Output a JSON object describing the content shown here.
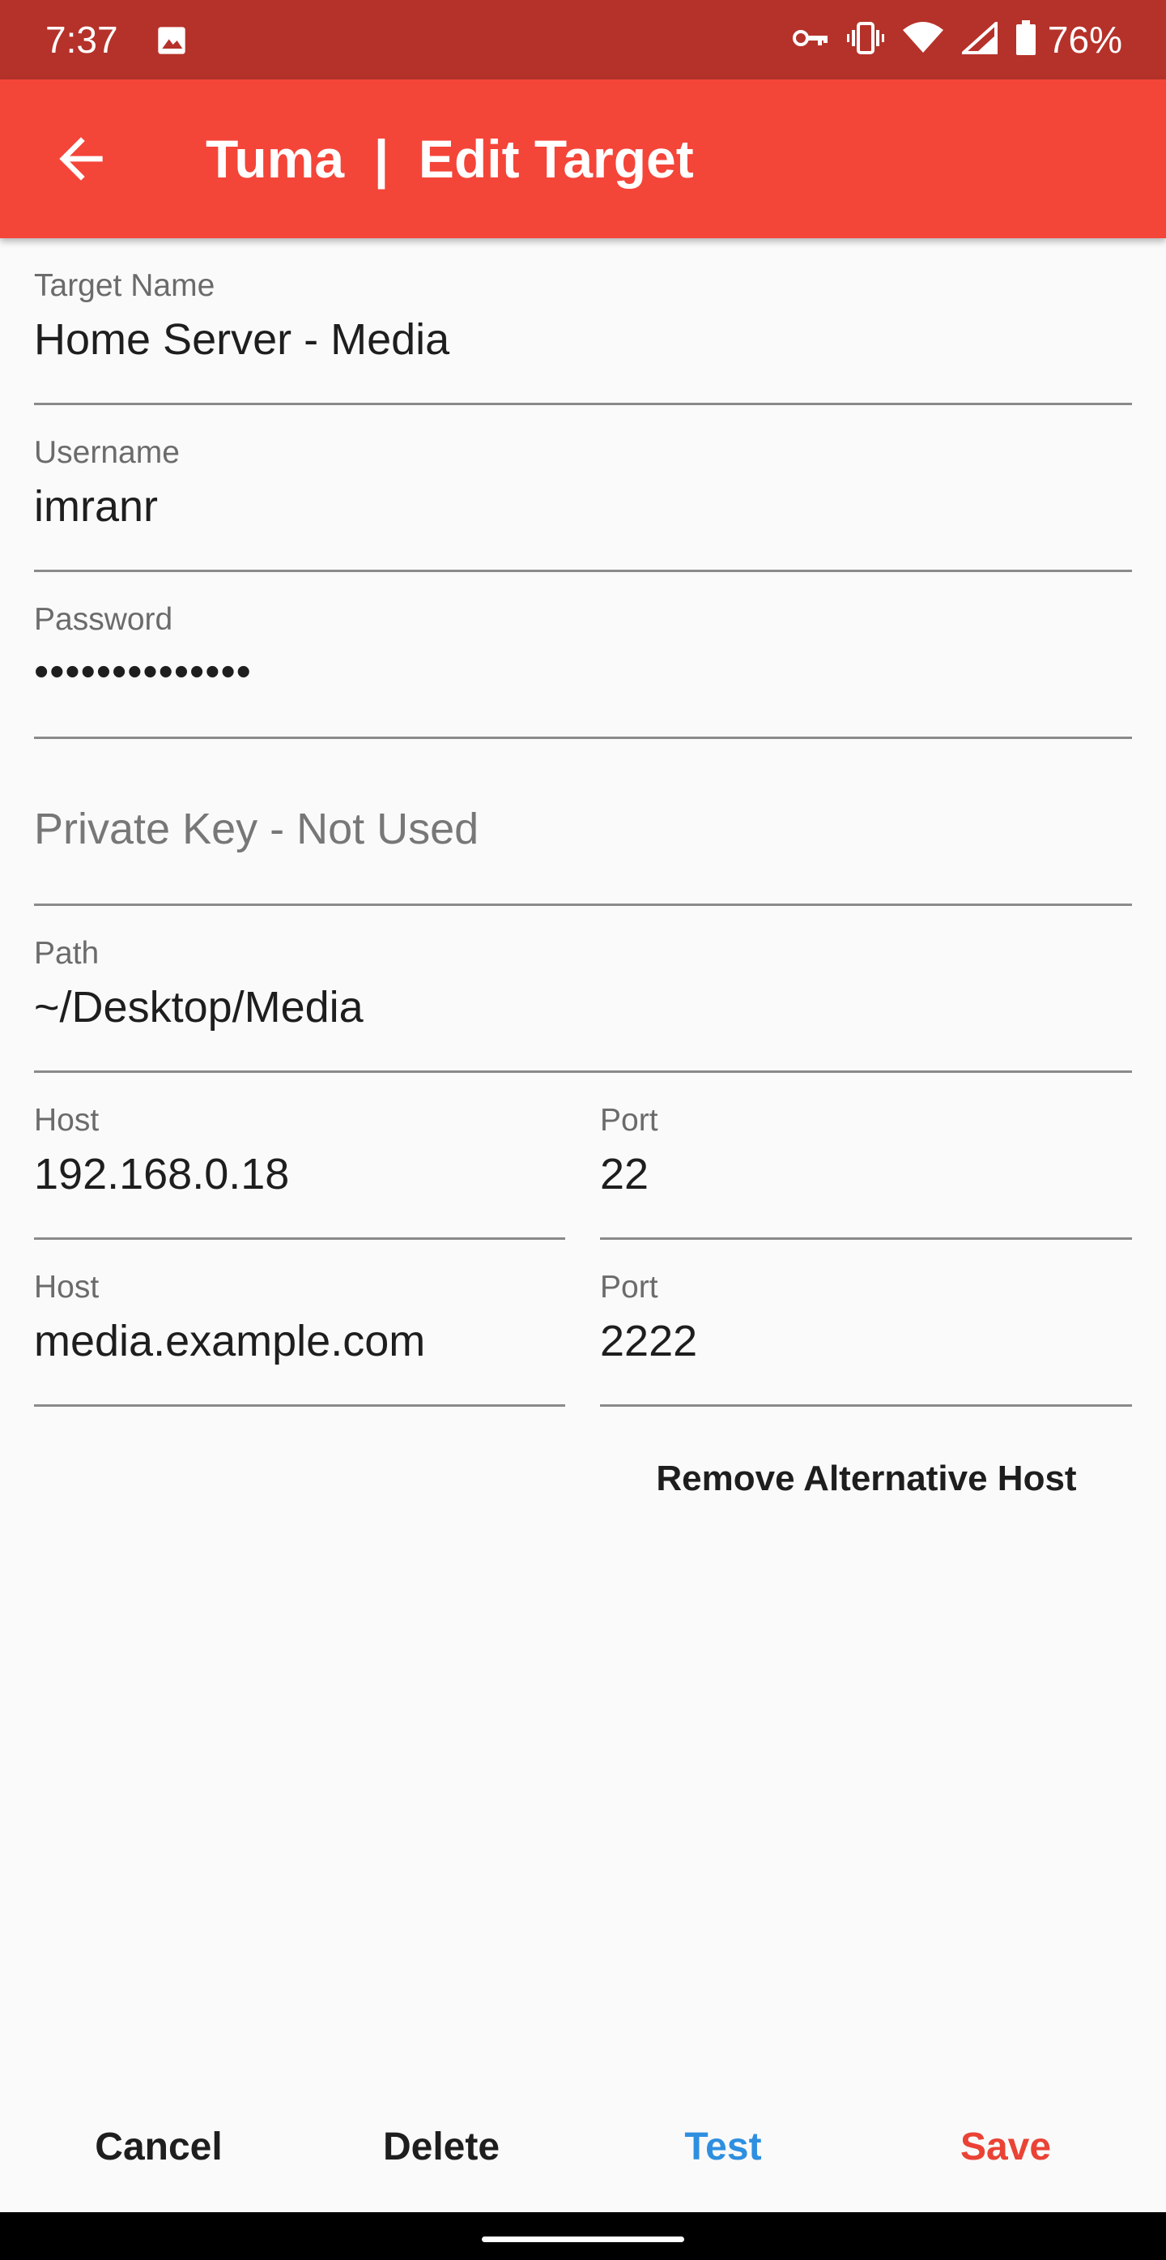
{
  "status_bar": {
    "time": "7:37",
    "battery": "76%",
    "icons": [
      "image-icon",
      "vpn-key-icon",
      "vibrate-icon",
      "wifi-icon",
      "signal-icon",
      "battery-icon"
    ]
  },
  "app_bar": {
    "title": "Tuma  |  Edit Target",
    "back_icon": "arrow-back-icon"
  },
  "form": {
    "target_name": {
      "label": "Target Name",
      "value": "Home Server - Media"
    },
    "username": {
      "label": "Username",
      "value": "imranr"
    },
    "password": {
      "label": "Password",
      "value": "••••••••••••••"
    },
    "private_key": {
      "placeholder": "Private Key  - Not Used"
    },
    "path": {
      "label": "Path",
      "value": "~/Desktop/Media"
    },
    "host": {
      "label": "Host",
      "value": "192.168.0.18"
    },
    "port": {
      "label": "Port",
      "value": "22"
    },
    "alt_host": {
      "label": "Host",
      "value": "media.example.com"
    },
    "alt_port": {
      "label": "Port",
      "value": "2222"
    },
    "remove_alt_label": "Remove Alternative Host"
  },
  "actions": {
    "cancel": "Cancel",
    "delete": "Delete",
    "test": "Test",
    "save": "Save"
  },
  "colors": {
    "status_bar": "#B5322A",
    "app_bar": "#F44539",
    "test": "#2E8FE0",
    "save": "#EA4335",
    "underline": "#8A8A8A"
  }
}
